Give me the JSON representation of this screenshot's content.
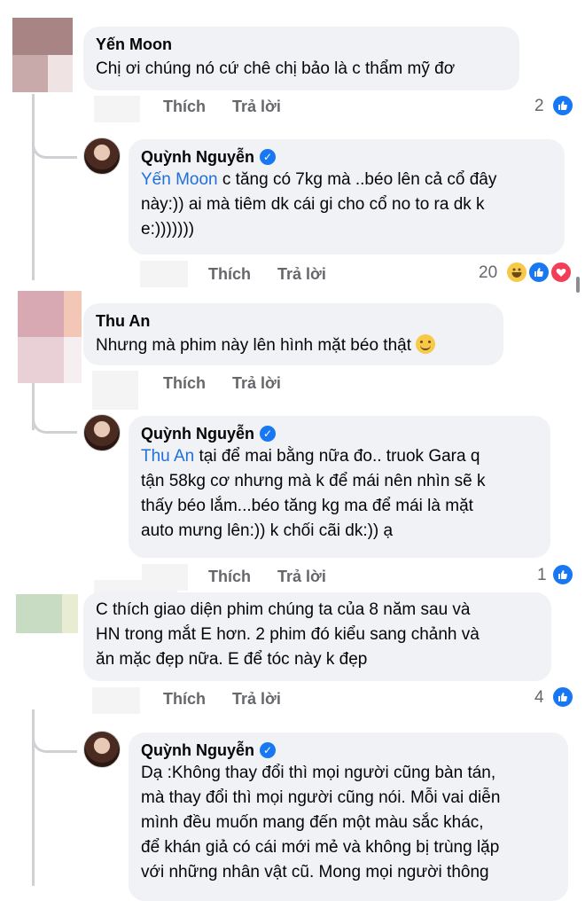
{
  "comments": [
    {
      "name": "Yến Moon",
      "text": "Chị ơi chúng nó cứ chê chị bảo là c thẩm mỹ đơ",
      "actions": {
        "like": "Thích",
        "reply": "Trả lời"
      },
      "reaction_count": "2"
    },
    {
      "name": "Quỳnh Nguyễn",
      "mention": "Yến Moon",
      "text_line1": " c tăng có 7kg mà ..béo lên cả cổ đây",
      "text_line2": "này:)) ai mà tiêm dk cái gi cho cổ no to ra dk k",
      "text_line3": "e:)))))))",
      "actions": {
        "like": "Thích",
        "reply": "Trả lời"
      },
      "reaction_count": "20"
    },
    {
      "name": "Thu An",
      "text": "Nhưng mà phim này lên hình mặt béo thật",
      "actions": {
        "like": "Thích",
        "reply": "Trả lời"
      }
    },
    {
      "name": "Quỳnh Nguyễn",
      "mention": "Thu An",
      "text_line1": " tại để mai bằng nữa đo.. truok Gara q",
      "text_line2": "tận 58kg cơ nhưng mà k để mái nên nhìn sẽ k",
      "text_line3": "thấy béo lắm...béo tăng kg ma để mái là mặt",
      "text_line4": "auto mưng lên:)) k chối cãi dk:)) ạ",
      "actions": {
        "like": "Thích",
        "reply": "Trả lời"
      },
      "reaction_count": "1"
    },
    {
      "text_line1": "C thích giao diện phim chúng ta của 8 năm sau và",
      "text_line2": "HN trong mắt E hơn. 2 phim đó kiểu sang chảnh và",
      "text_line3": "ăn mặc đẹp nữa. E để tóc này k đẹp",
      "actions": {
        "like": "Thích",
        "reply": "Trả lời"
      },
      "reaction_count": "4"
    },
    {
      "name": "Quỳnh Nguyễn",
      "text_line1": "Dạ :Không thay đổi thì mọi người cũng bàn tán,",
      "text_line2": "mà thay đổi thì mọi người cũng nói. Mỗi vai diễn",
      "text_line3": "mình đều muốn mang đến một màu sắc khác,",
      "text_line4": "để khán giả có cái mới mẻ và không bị trùng lặp",
      "text_line5": "với những nhân vật cũ. Mong mọi người thông"
    }
  ],
  "icons": {
    "like": "like-icon",
    "haha": "haha-icon",
    "love": "love-icon",
    "verified": "verified-badge-icon",
    "smile": "smile-emoji-icon"
  },
  "colors": {
    "mention": "#216fdb",
    "bubble": "#f0f2f5",
    "like": "#1877f2",
    "love": "#f33e58"
  }
}
